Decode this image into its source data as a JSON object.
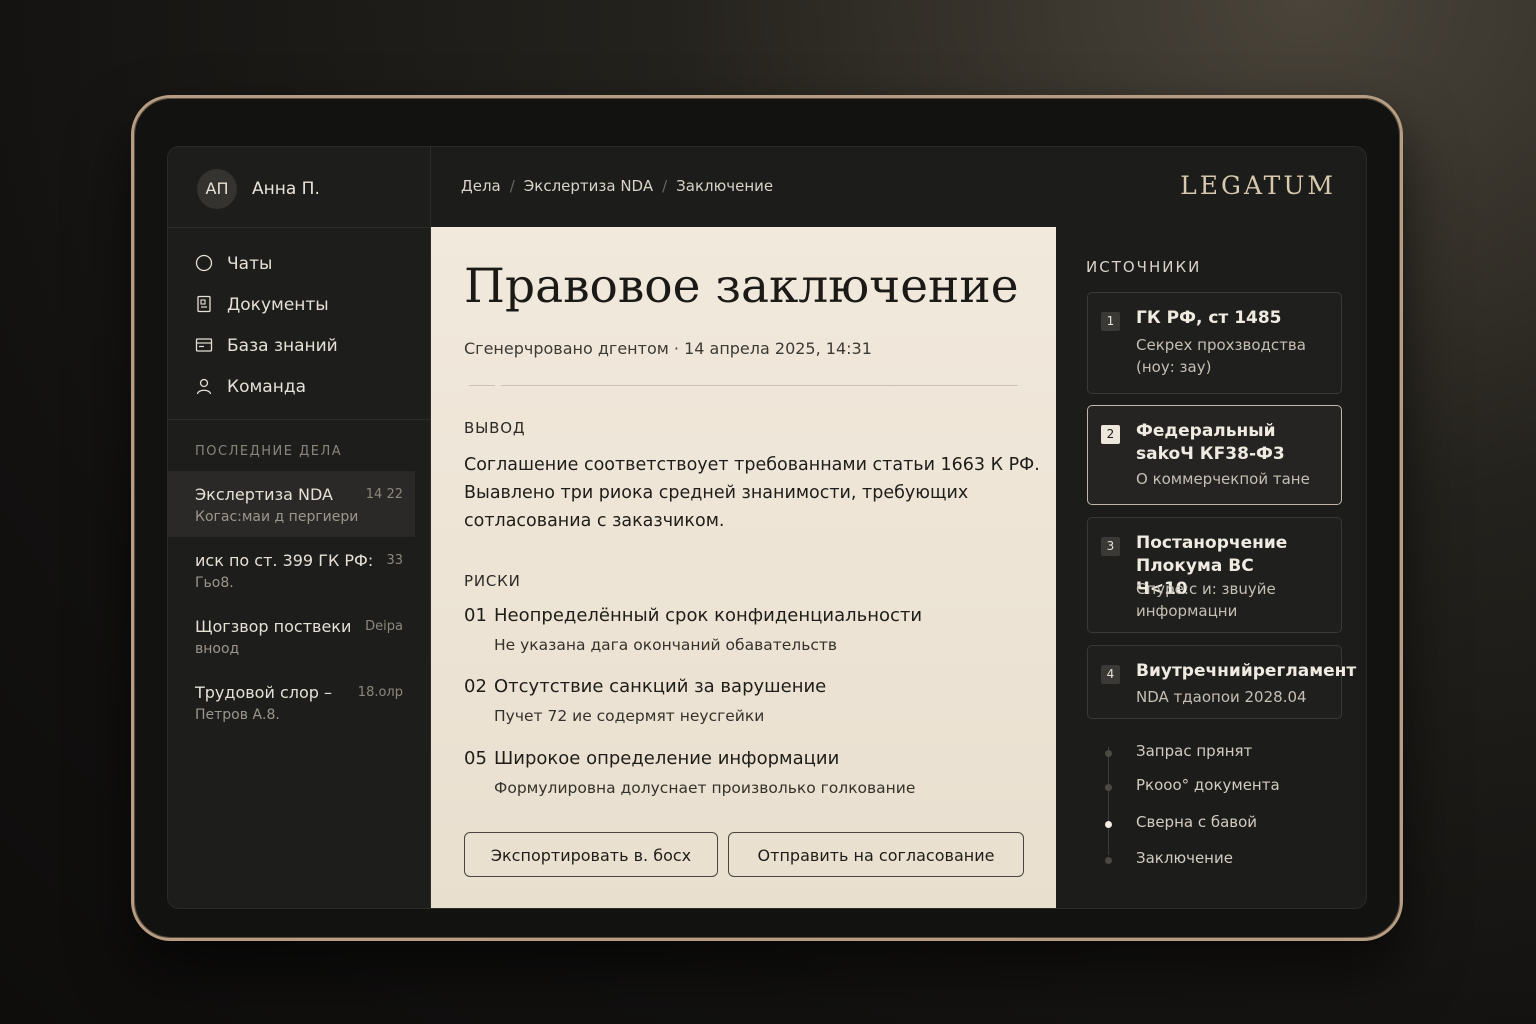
{
  "user": {
    "initials": "АП",
    "name": "Анна П."
  },
  "nav": [
    {
      "label": "Чаты",
      "icon": "chat-circle-icon"
    },
    {
      "label": "Документы",
      "icon": "document-icon"
    },
    {
      "label": "База знаний",
      "icon": "knowledge-base-icon"
    },
    {
      "label": "Команда",
      "icon": "team-icon"
    }
  ],
  "recent": {
    "heading": "ПОСЛЕДНИЕ ДЕЛА",
    "cases": [
      {
        "title": "Экслертиза NDA",
        "subtitle": "Когас:маи д пергиери",
        "time": "14 22",
        "active": true
      },
      {
        "title": "иск по ст. 399 ГК РФ:",
        "subtitle": "Гьо8.",
        "time": "33",
        "active": false
      },
      {
        "title": "Щогзвор поствеки",
        "subtitle": "внοод",
        "time": "Deipa",
        "active": false
      },
      {
        "title": "Трудовой слор –",
        "subtitle": "Петров А.8.",
        "time": "18.олр",
        "active": false
      }
    ]
  },
  "breadcrumb": [
    "Дела",
    "Экслертиза NDA",
    "Заключение"
  ],
  "brand": "LEGATUM",
  "document": {
    "title": "Правовое заключение",
    "meta": "Сгенерчровано дгентом · 14 апрела 2025, 14:31",
    "conclusion_heading": "ВЫВОД",
    "conclusion_text": "Соглашение соответствоует требованнами статьи 1663 К РФ. Выавлено три риока средней знанимости, требующих сотласованиа с заказчиком.",
    "risks_heading": "РИСКИ",
    "risks": [
      {
        "num": "01",
        "title": "Неопределённый срок конфиденциальности",
        "desc": "Не указана дага окончаний обавательств"
      },
      {
        "num": "02",
        "title": "Отсутствие санкций за варушение",
        "desc": "Пучет 72 ие содермят неусгейки"
      },
      {
        "num": "05",
        "title": "Широкое определение информации",
        "desc": "Формулировна долуснает произволько голкование"
      }
    ],
    "export_button": "Экспортировать в. босх",
    "send_button": "Отправить на согласование"
  },
  "sources": {
    "heading": "ИСТОЧНИКИ",
    "items": [
      {
        "num": "1",
        "title": "ГК РФ, ст  1485",
        "desc": "Секрех прохзводства (ноу: зау)",
        "selected": false
      },
      {
        "num": "2",
        "title": "Федеральный sakoЧ КF38-Ф3",
        "desc": "О коммерчекпой тане",
        "selected": true
      },
      {
        "num": "3",
        "title": "Постанорчение Плокума ВС Ч<10",
        "desc": "Спуре:с и: звuуйе информацни",
        "selected": false
      },
      {
        "num": "4",
        "title": "Виутречнийрегламент",
        "desc": "NDA тдаопои 2028.04",
        "selected": false
      }
    ]
  },
  "timeline": [
    {
      "label": "Запрас прянят",
      "active": false
    },
    {
      "label": "Ркооо° документа",
      "active": false
    },
    {
      "label": "Сверна с бавой",
      "active": true
    },
    {
      "label": "Заключение",
      "active": false
    }
  ],
  "colors": {
    "accent_frame": "#b79d83",
    "doc_bg": "#f1e9dc",
    "brand": "#d8c8ad"
  }
}
